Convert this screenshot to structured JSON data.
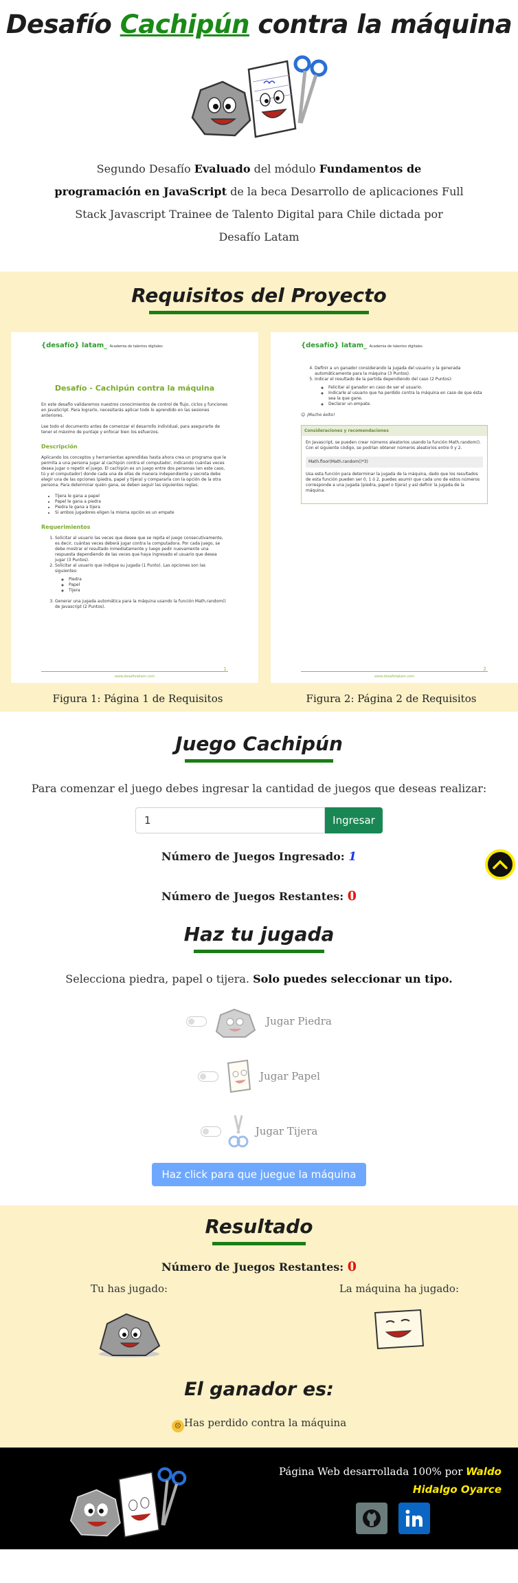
{
  "header": {
    "title_pre": "Desafío ",
    "title_highlight": "Cachipún",
    "title_post": " contra la máquina",
    "intro_1": "Segundo Desafío ",
    "intro_2": "Evaluado",
    "intro_3": " del módulo ",
    "intro_4": "Fundamentos de programación en JavaScript",
    "intro_5": " de la beca Desarrollo de aplicaciones Full Stack Javascript Trainee de Talento Digital para Chile dictada por Desafío Latam"
  },
  "requisitos": {
    "title": "Requisitos del Proyecto",
    "page1": {
      "logo": "{desafío} latam_",
      "logo_sub": "Academia de talentos digitales",
      "title": "Desafío - Cachipún contra la máquina",
      "p1": "En este desafío validaremos nuestros conocimientos de control de flujo, ciclos y funciones en JavaScript. Para lograrlo, necesitarás aplicar todo lo aprendido en las sesiones anteriores.",
      "p2": "Lee todo el documento antes de comenzar el desarrollo individual, para asegurarte de tener el máximo de puntaje y enfocar bien los esfuerzos.",
      "h_desc": "Descripción",
      "p3": "Aplicando los conceptos y herramientas aprendidas hasta ahora crea un programa que le permita a una persona jugar al cachipún contra el computador, indicando cuántas veces desea jugar o repetir el juego. El cachipún es un juego entre dos personas (en este caso, tú y el computador) donde cada una de ellas de manera independiente y secreta debe elegir una de las opciones (piedra, papel y tijera) y compararla con la opción de la otra persona. Para determinar quién gana, se deben seguir las siguientes reglas:",
      "rules": [
        "Tijera le gana a papel",
        "Papel le gana a piedra",
        "Piedra le gana a tijera",
        "Si ambos jugadores eligen la misma opción es un empate"
      ],
      "h_req": "Requerimientos",
      "req1": "Solicitar al usuario las veces que desee que se repita el juego consecutivamente, es decir, cuántas veces deberá jugar contra la computadora. Por cada juego, se debe mostrar el resultado inmediatamente y luego pedir nuevamente una respuesta dependiendo de las veces que haya ingresado el usuario que desea jugar (3 Puntos).",
      "req2": "Solicitar al usuario que indique su jugada (1 Punto). Las opciones son las siguientes:",
      "opts": [
        "Piedra",
        "Papel",
        "Tijera"
      ],
      "req3": "Generar una jugada automática para la máquina usando la función Math.random() de Javascript (2 Puntos).",
      "footer": "www.desafiolatam.com",
      "num": "1"
    },
    "page2": {
      "logo": "{desafío} latam_",
      "logo_sub": "Academia de talentos digitales",
      "req4": "Definir a un ganador considerando la jugada del usuario y la generada automáticamente para la máquina (3 Puntos).",
      "req5": "Indicar el resultado de la partida dependiendo del caso (2 Puntos):",
      "res": [
        "Felicitar al ganador en caso de ser el usuario.",
        "Indicarle al usuario que ha perdido contra la máquina en caso de que ésta sea la que gane.",
        "Declarar un empate."
      ],
      "luck": "¡Mucho éxito!",
      "box_title": "Consideraciones y recomendaciones",
      "box_p1": "En Javascript, se pueden crear números aleatorios usando la función Math.random(). Con el siguiente código, se podrían obtener números aleatorios entre 0 y 2.",
      "code": "Math.floor(Math.random()*3)",
      "box_p2": "Usa esta función para determinar la jugada de la máquina, dado que los resultados de esta función pueden ser 0, 1 ó 2, puedes asumir que cada uno de estos números corresponde a una jugada (piedra, papel o tijera) y así definir la jugada de la máquina.",
      "footer": "www.desafiolatam.com",
      "num": "2"
    },
    "caption1": "Figura 1: Página 1 de Requisitos",
    "caption2": "Figura 2: Página 2 de Requisitos"
  },
  "juego": {
    "title": "Juego Cachipún",
    "prompt": "Para comenzar el juego debes ingresar la cantidad de juegos que deseas realizar:",
    "input_value": "1",
    "button": "Ingresar",
    "ingresados_label": "Número de Juegos Ingresado: ",
    "ingresados_value": "1",
    "restantes_label": "Número de Juegos Restantes: ",
    "restantes_value": "0"
  },
  "jugada": {
    "title": "Haz tu jugada",
    "prompt_1": "Selecciona piedra, papel o tijera. ",
    "prompt_2": "Solo puedes seleccionar un tipo.",
    "opt_piedra": "Jugar Piedra",
    "opt_papel": "Jugar Papel",
    "opt_tijera": "Jugar Tijera",
    "machine_button": "Haz click para que juegue la máquina"
  },
  "resultado": {
    "title": "Resultado",
    "restantes_label": "Número de Juegos Restantes: ",
    "restantes_value": "0",
    "user_label": "Tu has jugado:",
    "machine_label": "La máquina ha jugado:",
    "ganador_title": "El ganador es:",
    "ganador_text": "Has perdido contra la máquina"
  },
  "footer": {
    "credit_1": "Página Web desarrollada 100% por ",
    "credit_name": "Waldo Hidalgo Oyarce"
  },
  "colors": {
    "accent_green": "#1a7d14",
    "section_yellow": "#fcf1c7",
    "primary_button": "#198754",
    "machine_button": "#6ea8fe",
    "footer_bg": "#000000",
    "highlight_yellow": "#ffea00"
  },
  "icons": [
    "rock-character-icon",
    "paper-character-icon",
    "scissors-character-icon",
    "chevron-up-icon",
    "github-icon",
    "linkedin-icon",
    "sad-face-icon"
  ]
}
